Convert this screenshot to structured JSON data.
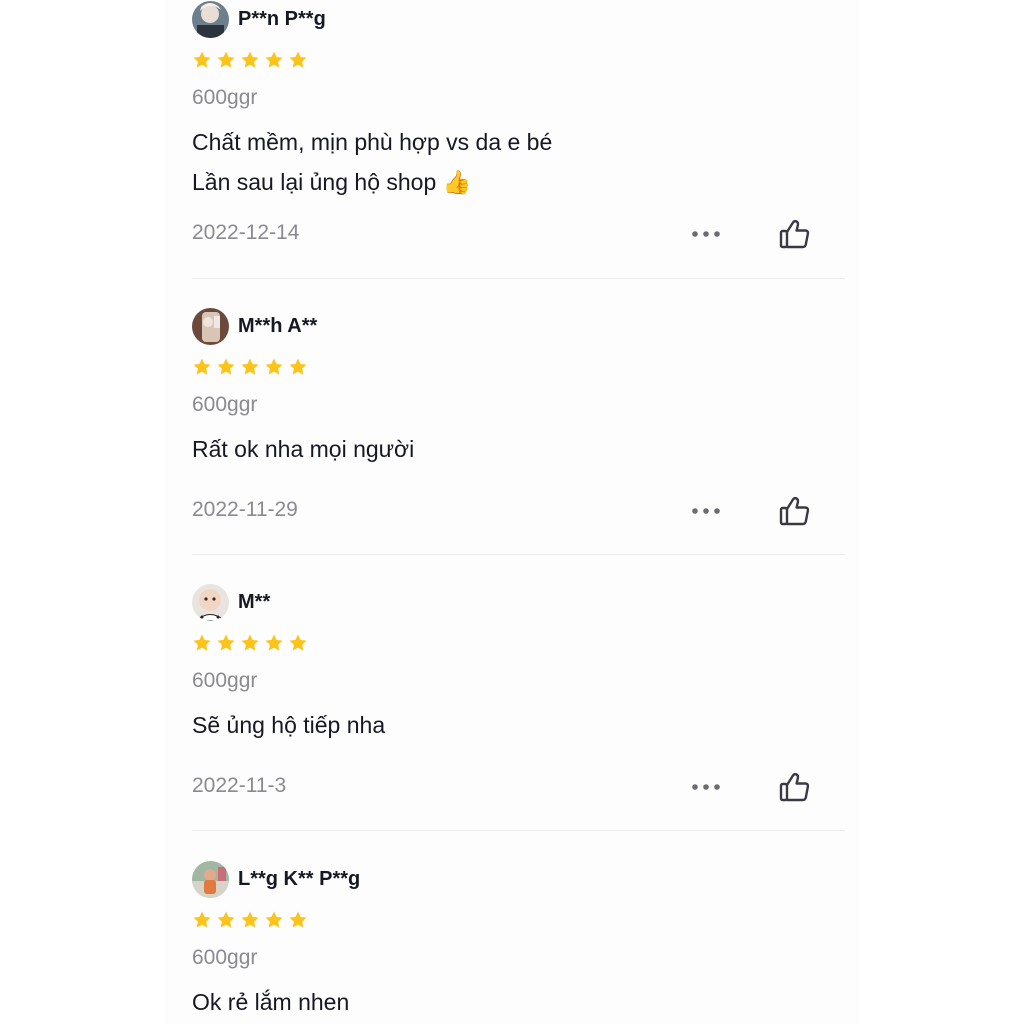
{
  "reviews": [
    {
      "user": "P**n P**g",
      "rating": 5,
      "variant": "600ggr",
      "comment": "Chất mềm, mịn phù hợp vs da e bé\nLần sau lại ủng hộ shop 👍",
      "date": "2022-12-14"
    },
    {
      "user": "M**h A**",
      "rating": 5,
      "variant": "600ggr",
      "comment": "Rất ok nha mọi người",
      "date": "2022-11-29"
    },
    {
      "user": "M**",
      "rating": 5,
      "variant": "600ggr",
      "comment": "Sẽ ủng hộ tiếp nha",
      "date": "2022-11-3"
    },
    {
      "user": "L**g K** P**g",
      "rating": 5,
      "variant": "600ggr",
      "comment": "Ok rẻ lắm nhen",
      "date": ""
    }
  ],
  "colors": {
    "star": "#fcc419",
    "muted_text": "#8a8b91",
    "primary_text": "#161823",
    "divider": "#ececec"
  },
  "icons": {
    "more": "more-dots-icon",
    "like": "thumbs-up-icon",
    "star": "star-icon"
  }
}
